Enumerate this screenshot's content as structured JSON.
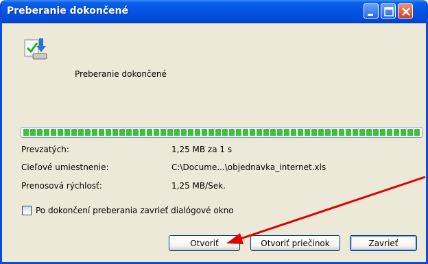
{
  "window": {
    "title": "Preberanie dokončené"
  },
  "status": {
    "heading": "Preberanie dokončené",
    "progress": 1.0
  },
  "details": [
    {
      "label": "Prevzatých:",
      "value": "1,25 MB za 1 s"
    },
    {
      "label": "Cieľové umiestnenie:",
      "value": "C:\\Docume...\\objednavka_internet.xls"
    },
    {
      "label": "Prenosová rýchlosť:",
      "value": "1,25 MB/Sek."
    }
  ],
  "options": {
    "close_on_complete_label": "Po dokončení preberania zavrieť dialógové okno",
    "close_on_complete_checked": false
  },
  "buttons": {
    "open": "Otvoriť",
    "open_folder": "Otvoriť priečinok",
    "close": "Zavrieť"
  },
  "colors": {
    "titlebar": "#0554e3",
    "progress": "#39c23f",
    "annotation_arrow": "#e00000"
  }
}
